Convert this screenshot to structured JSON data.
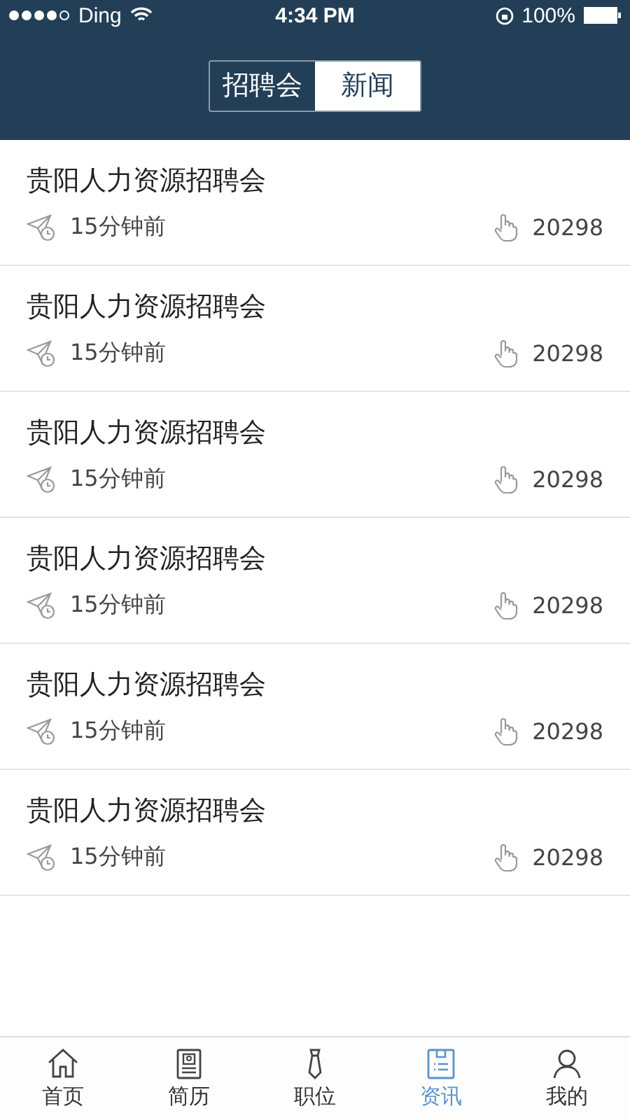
{
  "status_bar": {
    "carrier": "Ding",
    "time": "4:34 PM",
    "battery": "100%"
  },
  "segments": [
    {
      "label": "招聘会",
      "selected": false
    },
    {
      "label": "新闻",
      "selected": true
    }
  ],
  "items": [
    {
      "title": "贵阳人力资源招聘会",
      "time": "15分钟前",
      "views": "20298"
    },
    {
      "title": "贵阳人力资源招聘会",
      "time": "15分钟前",
      "views": "20298"
    },
    {
      "title": "贵阳人力资源招聘会",
      "time": "15分钟前",
      "views": "20298"
    },
    {
      "title": "贵阳人力资源招聘会",
      "time": "15分钟前",
      "views": "20298"
    },
    {
      "title": "贵阳人力资源招聘会",
      "time": "15分钟前",
      "views": "20298"
    },
    {
      "title": "贵阳人力资源招聘会",
      "time": "15分钟前",
      "views": "20298"
    }
  ],
  "tab_bar": [
    {
      "label": "首页",
      "selected": false
    },
    {
      "label": "简历",
      "selected": false
    },
    {
      "label": "职位",
      "selected": false
    },
    {
      "label": "资讯",
      "selected": true
    },
    {
      "label": "我的",
      "selected": false
    }
  ]
}
